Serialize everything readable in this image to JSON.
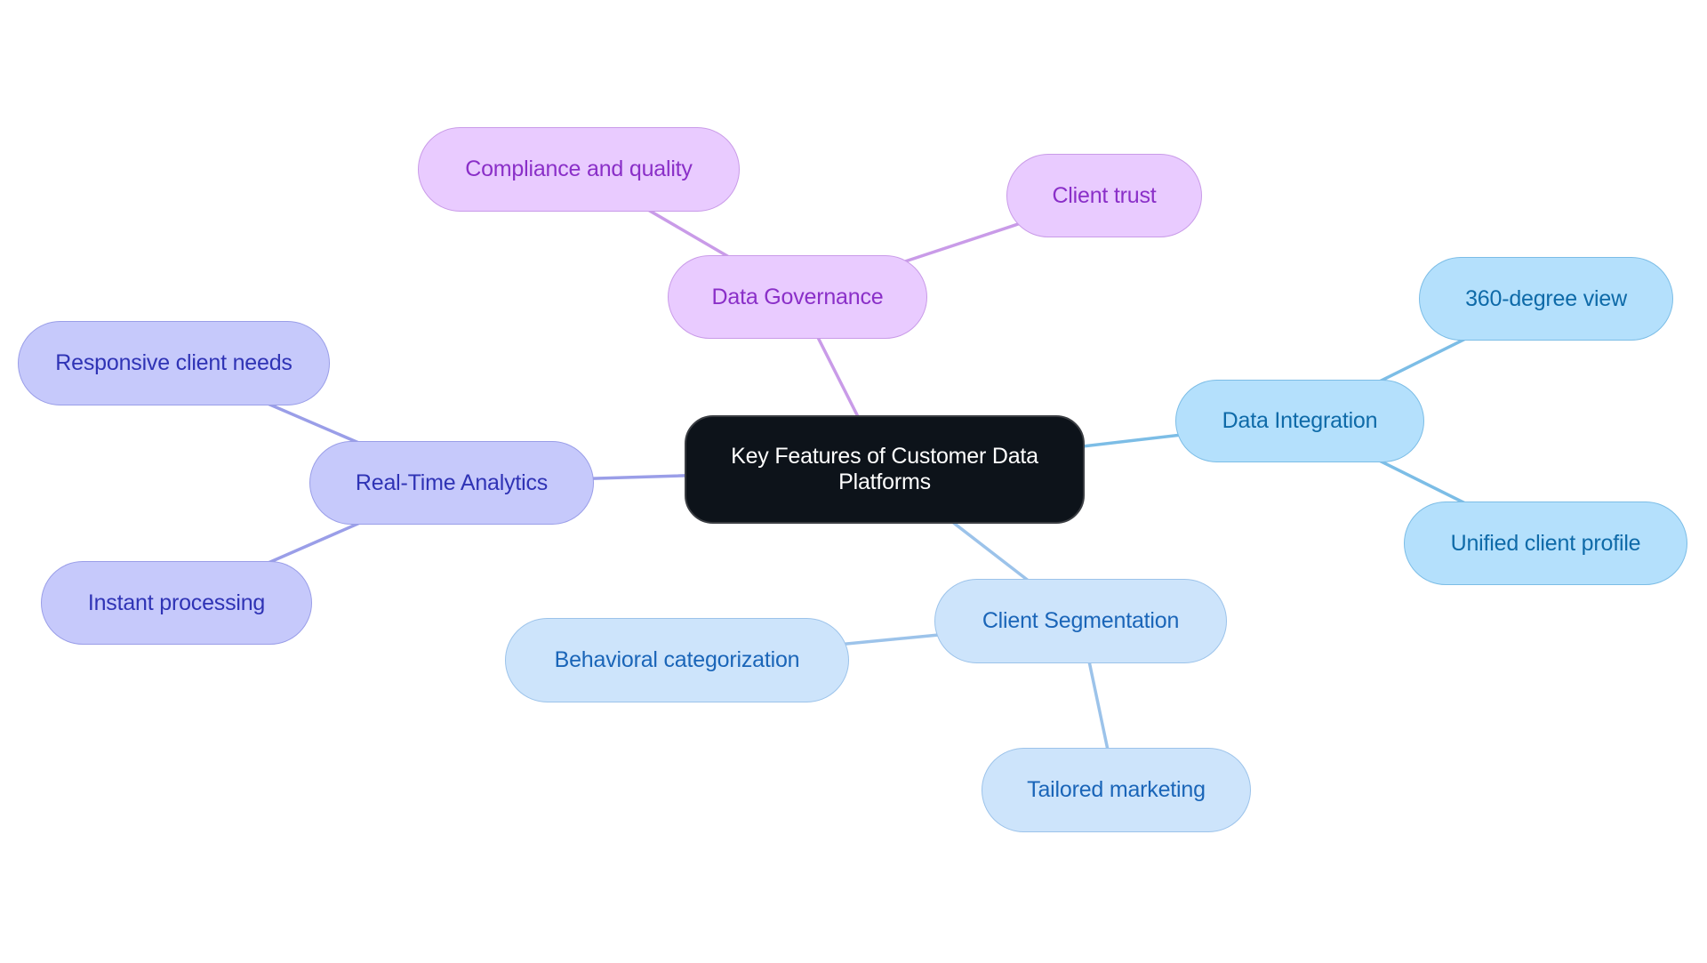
{
  "diagram": {
    "type": "mindmap",
    "root": {
      "id": "root",
      "label": "Key Features of Customer Data Platforms"
    },
    "branches": [
      {
        "id": "governance",
        "label": "Data Governance",
        "color_fill": "#e9cbff",
        "color_text": "#8a2fc8",
        "color_edge": "#c99be8",
        "children": [
          {
            "id": "compliance",
            "label": "Compliance and quality"
          },
          {
            "id": "trust",
            "label": "Client trust"
          }
        ]
      },
      {
        "id": "integration",
        "label": "Data Integration",
        "color_fill": "#b4e0fc",
        "color_text": "#0e6aa8",
        "color_edge": "#7cbde6",
        "children": [
          {
            "id": "view360",
            "label": "360-degree view"
          },
          {
            "id": "unified",
            "label": "Unified client profile"
          }
        ]
      },
      {
        "id": "segmentation",
        "label": "Client Segmentation",
        "color_fill": "#cde4fb",
        "color_text": "#1a65b8",
        "color_edge": "#9cc3ea",
        "children": [
          {
            "id": "behavioral",
            "label": "Behavioral categorization"
          },
          {
            "id": "tailored",
            "label": "Tailored marketing"
          }
        ]
      },
      {
        "id": "analytics",
        "label": "Real-Time Analytics",
        "color_fill": "#c6c9fb",
        "color_text": "#2f33b5",
        "color_edge": "#9a9ee8",
        "children": [
          {
            "id": "responsive",
            "label": "Responsive client needs"
          },
          {
            "id": "instant",
            "label": "Instant processing"
          }
        ]
      }
    ],
    "root_fill": "#0d131a",
    "root_text": "#ffffff"
  }
}
